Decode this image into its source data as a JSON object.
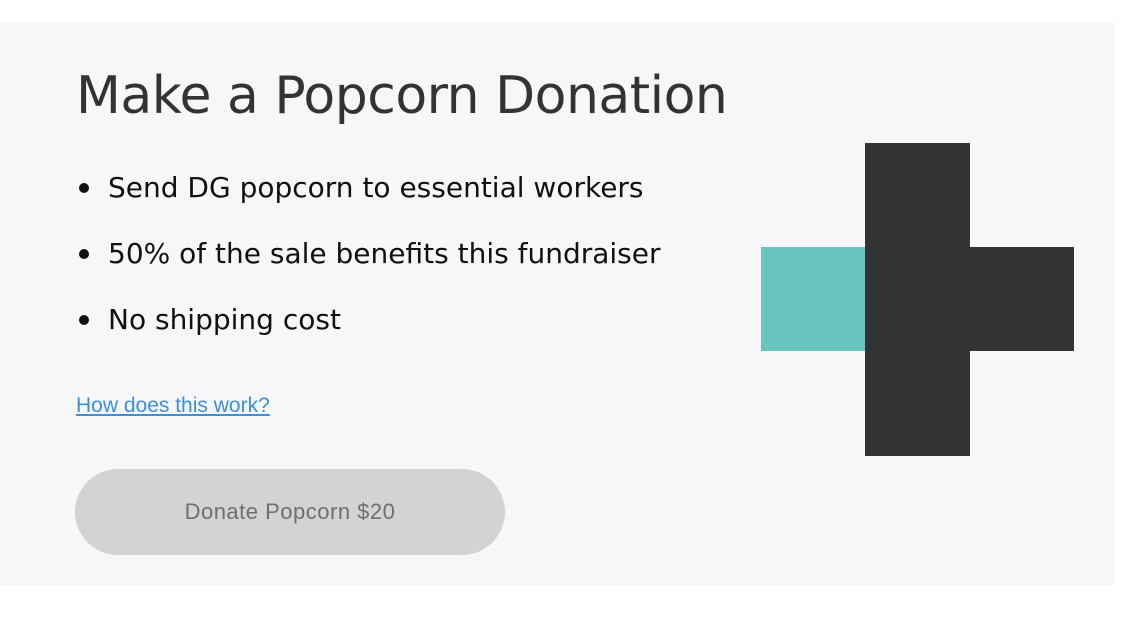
{
  "donation": {
    "title": "Make a Popcorn Donation",
    "bullets": [
      "Send DG popcorn to essential workers",
      "50% of the sale benefits this fundraiser",
      "No shipping cost"
    ],
    "help_link": "How does this work?",
    "donate_button": "Donate Popcorn $20"
  },
  "logo": {
    "icon": "plus-logo-icon",
    "colors": {
      "teal": "#69c5bd",
      "dark": "#333333"
    }
  },
  "colors": {
    "background": "#f7f7f9",
    "link": "#3a8fde",
    "button_bg": "#d3d3d3",
    "button_text": "#6f6f6f"
  }
}
